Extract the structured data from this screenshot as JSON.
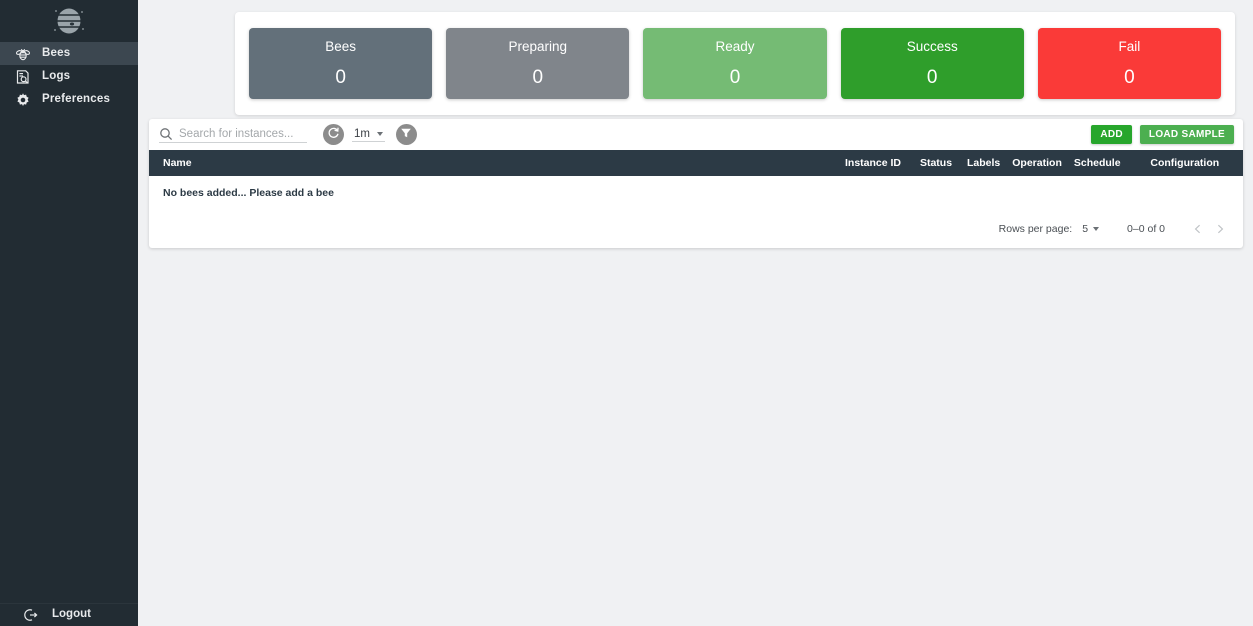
{
  "sidebar": {
    "logo": "beehive-logo",
    "items": [
      {
        "label": "Bees",
        "icon": "bee-icon",
        "active": true
      },
      {
        "label": "Logs",
        "icon": "logs-search-icon",
        "active": false
      },
      {
        "label": "Preferences",
        "icon": "gear-icon",
        "active": false
      }
    ],
    "logout": {
      "label": "Logout",
      "icon": "logout-icon"
    },
    "colors": {
      "background": "#222c33",
      "active": "#3c4750",
      "text": "#e8eaec"
    }
  },
  "status_cards": [
    {
      "label": "Bees",
      "value": "0",
      "color": "#63707a"
    },
    {
      "label": "Preparing",
      "value": "0",
      "color": "#80858b"
    },
    {
      "label": "Ready",
      "value": "0",
      "color": "#75bb74"
    },
    {
      "label": "Success",
      "value": "0",
      "color": "#2f9e2b"
    },
    {
      "label": "Fail",
      "value": "0",
      "color": "#fa3a38"
    }
  ],
  "toolbar": {
    "search": {
      "placeholder": "Search for instances...",
      "value": "",
      "icon": "search-icon"
    },
    "refresh": {
      "icon": "refresh-icon"
    },
    "interval": {
      "value": "1m",
      "icon": "chevron-down-icon"
    },
    "filter": {
      "icon": "filter-funnel-icon"
    },
    "add_label": "ADD",
    "load_sample_label": "LOAD SAMPLE"
  },
  "table": {
    "columns": [
      "Name",
      "Instance ID",
      "Status",
      "Labels",
      "Operation",
      "Schedule",
      "Configuration"
    ],
    "rows": [],
    "empty_message": "No bees added... Please add a bee",
    "header_color": "#2c3a45"
  },
  "pagination": {
    "rows_per_page_label": "Rows per page:",
    "rows_per_page_value": "5",
    "range_text": "0–0 of 0",
    "prev_icon": "chevron-left-icon",
    "next_icon": "chevron-right-icon"
  }
}
